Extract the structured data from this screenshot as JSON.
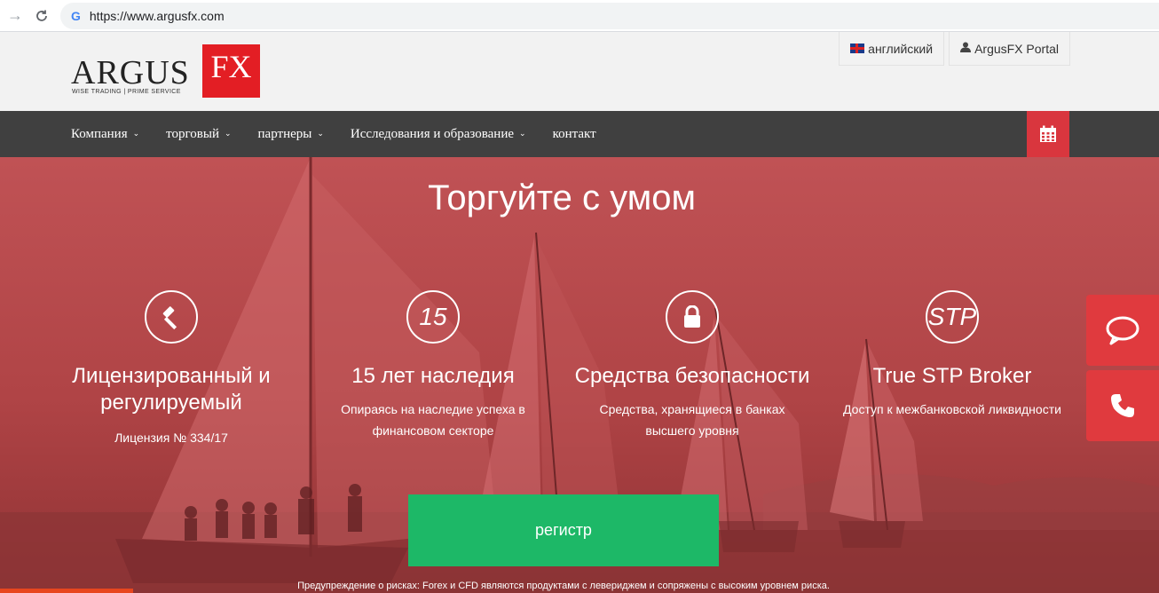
{
  "browser": {
    "url": "https://www.argusfx.com"
  },
  "header": {
    "logo_main": "ARGUS",
    "logo_sub": "WISE TRADING | PRIME SERVICE",
    "logo_fx": "FX",
    "language_label": "английский",
    "portal_label": "ArgusFX Portal"
  },
  "nav": {
    "items": [
      {
        "label": "Компания",
        "has_dropdown": true
      },
      {
        "label": "торговый",
        "has_dropdown": true
      },
      {
        "label": "партнеры",
        "has_dropdown": true
      },
      {
        "label": "Исследования и образование",
        "has_dropdown": true
      },
      {
        "label": "контакт",
        "has_dropdown": false
      }
    ],
    "calendar_icon": "calendar-icon"
  },
  "hero": {
    "title": "Торгуйте с умом",
    "features": [
      {
        "icon": "gavel-icon",
        "icon_text": "",
        "title_line1": "Лицензированный и",
        "title_line2": "регулируемый",
        "text_line1": "Лицензия № 334/17",
        "text_line2": ""
      },
      {
        "icon": "fifteen-icon",
        "icon_text": "15",
        "title_line1": "15 лет наследия",
        "title_line2": "",
        "text_line1": "Опираясь на наследие успеха в",
        "text_line2": "финансовом секторе"
      },
      {
        "icon": "lock-icon",
        "icon_text": "",
        "title_line1": "Средства безопасности",
        "title_line2": "",
        "text_line1": "Средства, хранящиеся в банках",
        "text_line2": "высшего уровня"
      },
      {
        "icon": "stp-icon",
        "icon_text": "STP",
        "title_line1": "True STP Broker",
        "title_line2": "",
        "text_line1": "Доступ к межбанковской ликвидности",
        "text_line2": ""
      }
    ],
    "register_label": "регистр",
    "risk_warning": "Предупреждение о рисках: Forex и CFD являются продуктами с левериджем и сопряжены с высоким уровнем риска."
  },
  "side_buttons": [
    "chat-icon",
    "phone-icon"
  ],
  "colors": {
    "brand_red": "#e31e24",
    "nav_bg": "#404040",
    "register_green": "#1db867",
    "side_red": "#e03a3e"
  }
}
